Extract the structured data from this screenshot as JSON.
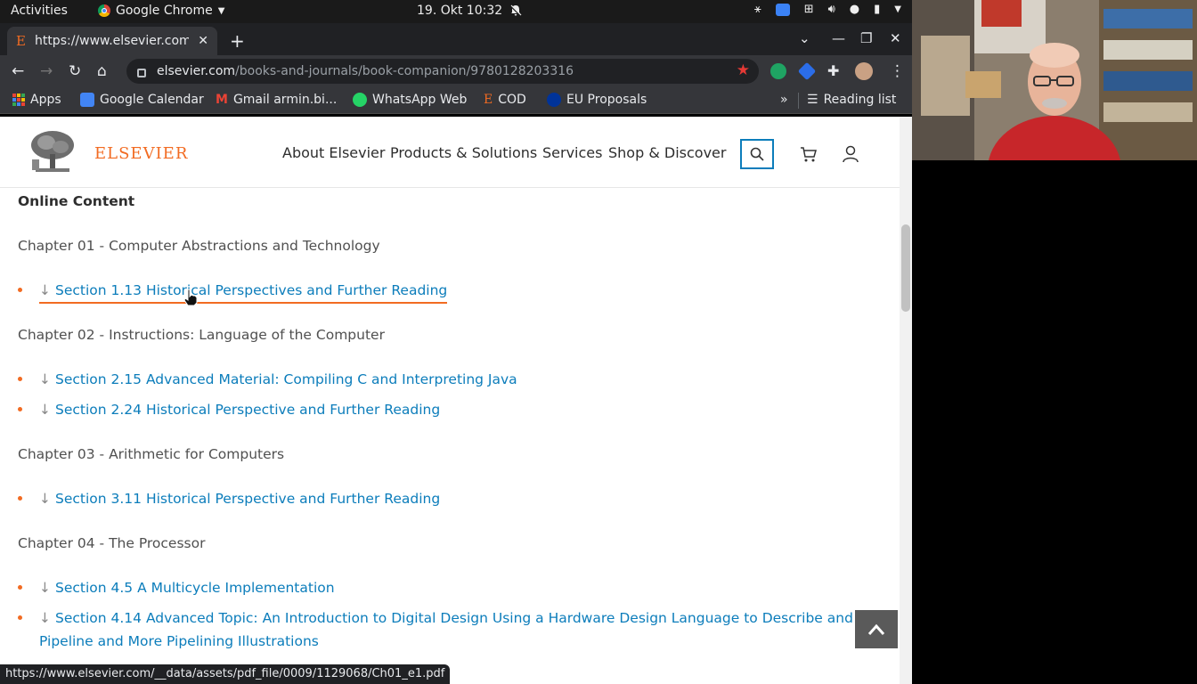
{
  "topbar": {
    "activities": "Activities",
    "app_name": "Google Chrome",
    "clock": "19. Okt  10:32"
  },
  "browser": {
    "tab_title": "https://www.elsevier.com",
    "url_host": "elsevier.com",
    "url_path": "/books-and-journals/book-companion/9780128203316",
    "bookmarks": [
      {
        "label": "Apps"
      },
      {
        "label": "Google Calendar"
      },
      {
        "label": "Gmail armin.bi..."
      },
      {
        "label": "WhatsApp Web"
      },
      {
        "label": "COD"
      },
      {
        "label": "EU Proposals"
      }
    ],
    "overflow": "»",
    "reading_list": "Reading list"
  },
  "site": {
    "logo": "ELSEVIER",
    "nav": [
      "About Elsevier",
      "Products & Solutions",
      "Services",
      "Shop & Discover"
    ]
  },
  "content": {
    "heading": "Online Content",
    "chapters": [
      {
        "title": "Chapter 01 - Computer Abstractions and Technology",
        "sections": [
          "Section 1.13 Historical Perspectives and Further Reading"
        ]
      },
      {
        "title": "Chapter 02 - Instructions: Language of the Computer",
        "sections": [
          "Section 2.15 Advanced Material: Compiling C and Interpreting Java",
          "Section 2.24 Historical Perspective and Further Reading"
        ]
      },
      {
        "title": "Chapter 03 - Arithmetic for Computers",
        "sections": [
          "Section 3.11 Historical Perspective and Further Reading"
        ]
      },
      {
        "title": "Chapter 04 - The Processor",
        "sections": [
          "Section 4.5 A Multicycle Implementation",
          "Section 4.14 Advanced Topic: An Introduction to Digital Design Using a Hardware Design Language to Describe and Model a",
          "Pipeline and More Pipelining Illustrations"
        ]
      }
    ]
  },
  "status_url": "https://www.elsevier.com/__data/assets/pdf_file/0009/1129068/Ch01_e1.pdf",
  "colors": {
    "accent": "#f26b22",
    "link": "#0c7dbb"
  }
}
